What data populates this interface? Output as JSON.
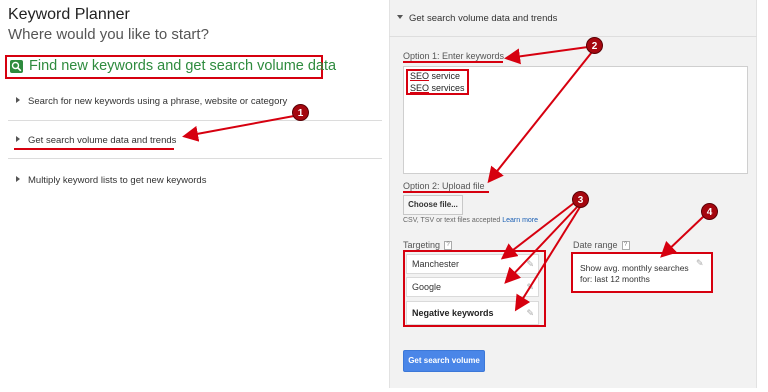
{
  "header": {
    "app_title": "Keyword Planner",
    "subtitle": "Where would you like to start?"
  },
  "find_section": {
    "label": "Find new keywords and get search volume data",
    "icon": "search-icon"
  },
  "left_menu": {
    "items": [
      {
        "label": "Search for new keywords using a phrase, website or category"
      },
      {
        "label": "Get search volume data and trends"
      },
      {
        "label": "Multiply keyword lists to get new keywords"
      }
    ]
  },
  "panel": {
    "title": "Get search volume data and trends",
    "option1_label": "Option 1: Enter keywords",
    "keywords": [
      {
        "seo": "SEO",
        "rest": " service"
      },
      {
        "seo": "SEO",
        "rest": " services"
      }
    ],
    "option2_label": "Option 2: Upload file",
    "choose_file_label": "Choose file...",
    "file_note": "CSV, TSV or text files accepted",
    "learn_more": "Learn more",
    "targeting_label": "Targeting",
    "targeting_help": "?",
    "targeting_rows": [
      {
        "label": "Manchester"
      },
      {
        "label": "Google"
      },
      {
        "label": "Negative keywords"
      }
    ],
    "date_range_label": "Date range",
    "date_range_help": "?",
    "date_range_text": "Show avg. monthly searches for: last 12 months",
    "submit_label": "Get search volume"
  },
  "markers": [
    "1",
    "2",
    "3",
    "4"
  ],
  "colors": {
    "annotation_red": "#d6000f",
    "marker_red": "#a5070f",
    "green_accent": "#2e8b3e",
    "button_blue": "#4a86e8",
    "panel_bg": "#f2f2f2"
  }
}
